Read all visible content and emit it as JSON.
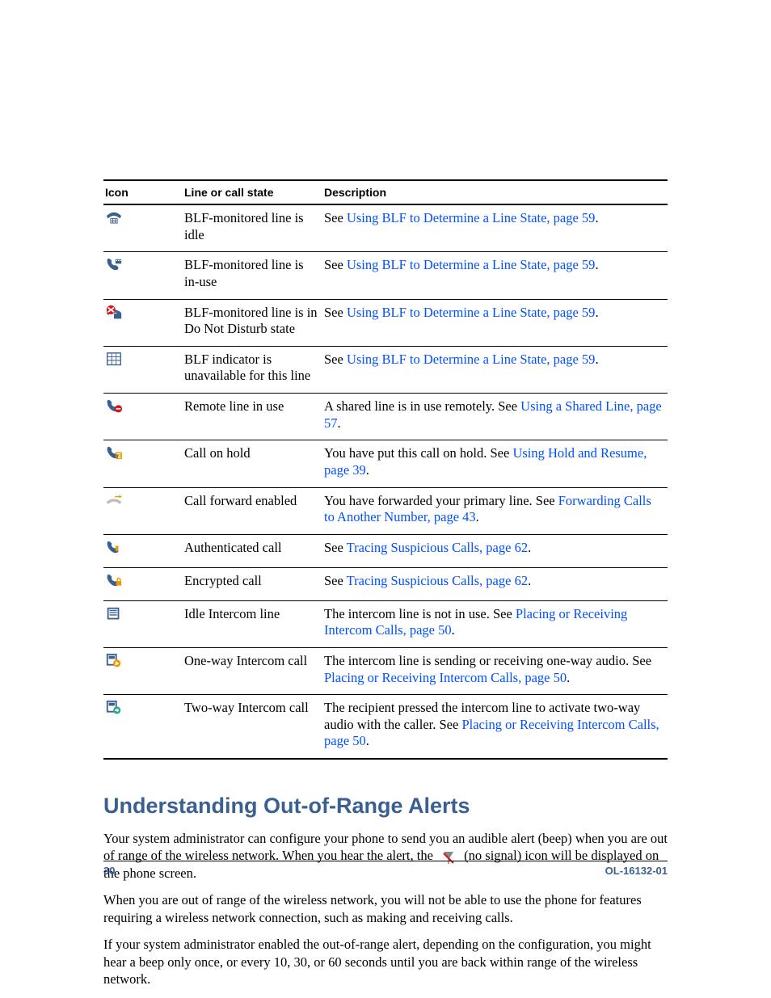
{
  "table": {
    "headers": {
      "icon": "Icon",
      "state": "Line or call state",
      "desc": "Description"
    },
    "rows": [
      {
        "state": "BLF-monitored line is idle",
        "pre": "See ",
        "link": "Using BLF to Determine a Line State, page 59",
        "post": "."
      },
      {
        "state": "BLF-monitored line is in-use",
        "pre": "See ",
        "link": "Using BLF to Determine a Line State, page 59",
        "post": "."
      },
      {
        "state": "BLF-monitored line is in Do Not Disturb state",
        "pre": "See ",
        "link": "Using BLF to Determine a Line State, page 59",
        "post": "."
      },
      {
        "state": "BLF indicator is unavailable for this line",
        "pre": "See ",
        "link": "Using BLF to Determine a Line State, page 59",
        "post": "."
      },
      {
        "state": "Remote line in use",
        "pre": "A shared line is in use remotely. See ",
        "link": "Using a Shared Line, page 57",
        "post": "."
      },
      {
        "state": "Call on hold",
        "pre": "You have put this call on hold. See ",
        "link": "Using Hold and Resume, page 39",
        "post": "."
      },
      {
        "state": "Call forward enabled",
        "pre": "You have forwarded your primary line. See ",
        "link": "Forwarding Calls to Another Number, page 43",
        "post": "."
      },
      {
        "state": "Authenticated call",
        "pre": "See ",
        "link": "Tracing Suspicious Calls, page 62",
        "post": "."
      },
      {
        "state": "Encrypted call",
        "pre": "See ",
        "link": "Tracing Suspicious Calls, page 62",
        "post": "."
      },
      {
        "state": "Idle Intercom line",
        "pre": "The intercom line is not in use. See ",
        "link": "Placing or Receiving Intercom Calls, page 50",
        "post": "."
      },
      {
        "state": "One-way Intercom call",
        "pre": "The intercom line is sending or receiving one-way audio. See ",
        "link": "Placing or Receiving Intercom Calls, page 50",
        "post": "."
      },
      {
        "state": "Two-way Intercom call",
        "pre": "The recipient pressed the intercom line to activate two-way audio with the caller. See ",
        "link": "Placing or Receiving Intercom Calls, page 50",
        "post": "."
      }
    ]
  },
  "section": {
    "heading": "Understanding Out-of-Range Alerts",
    "p1a": "Your system administrator can configure your phone to send you an audible alert (beep) when you are out of range of the wireless network. When you hear the alert, the ",
    "p1b": " (no signal) icon will be displayed on the phone screen.",
    "p2": "When you are out of range of the wireless network, you will not be able to use the phone for features requiring a wireless network connection, such as making and receiving calls.",
    "p3": "If your system administrator enabled the out-of-range alert, depending on the configuration, you might hear a beep only once, or every 10, 30, or 60 seconds until you are back within range of the wireless network."
  },
  "footer": {
    "page": "30",
    "doc": "OL-16132-01"
  }
}
